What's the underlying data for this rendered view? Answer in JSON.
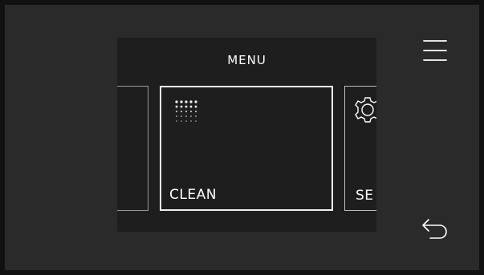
{
  "menu": {
    "title": "MENU",
    "tiles": [
      {
        "label": "",
        "icon": "partial-tile"
      },
      {
        "label": "CLEAN",
        "icon": "dot-grid-icon"
      },
      {
        "label": "SE",
        "icon": "gear-icon"
      }
    ]
  },
  "controls": {
    "menu_icon": "hamburger-menu-icon",
    "back_icon": "back-arrow-icon"
  },
  "colors": {
    "screen_background": "#2a2a2a",
    "panel_background": "#1e1e1e",
    "foreground": "#ffffff"
  }
}
